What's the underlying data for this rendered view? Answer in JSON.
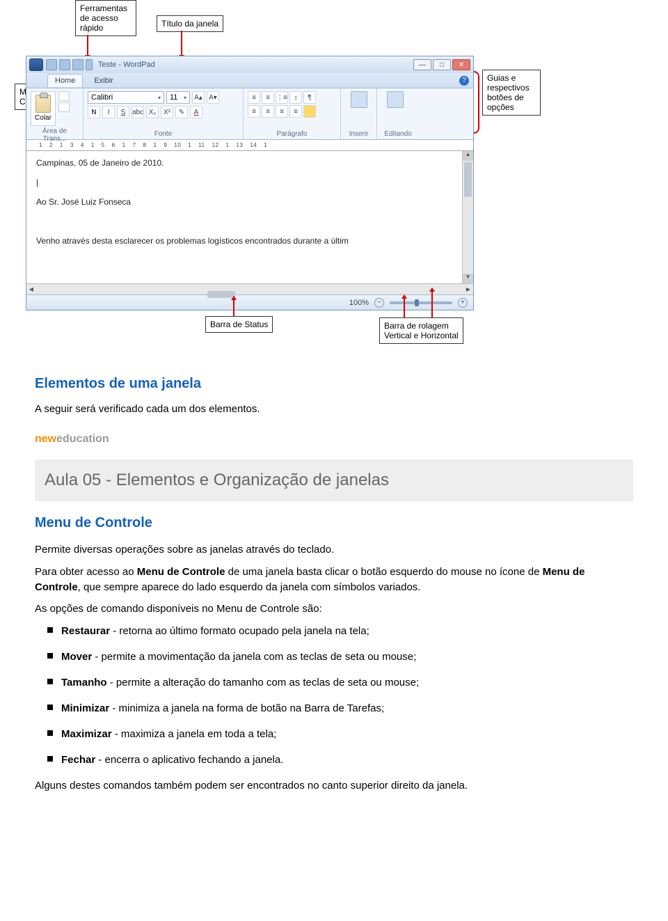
{
  "callouts": {
    "quick_access": "Ferramentas\nde acesso\nrápido",
    "title_bar": "Título da janela",
    "control_menu": "Menu de\nControle",
    "tabs_buttons": "Guias e\nrespectivos\nbotões de\nopções",
    "status_bar": "Barra de Status",
    "scroll_bars": "Barra de rolagem\nVertical e Horizontal"
  },
  "window": {
    "title": "Teste - WordPad",
    "tabs": {
      "home": "Home",
      "view": "Exibir"
    },
    "groups": {
      "clipboard": {
        "paste": "Colar",
        "label": "Área de Trans..."
      },
      "font": {
        "name": "Calibri",
        "size": "11",
        "label": "Fonte"
      },
      "paragraph": {
        "label": "Parágrafo"
      },
      "insert": {
        "label": "Inserir"
      },
      "editing": {
        "label": "Editando"
      }
    },
    "ruler": [
      "1",
      "2",
      "1",
      "3",
      "4",
      "1",
      "5",
      "6",
      "1",
      "7",
      "8",
      "1",
      "9",
      "10",
      "1",
      "11",
      "12",
      "1",
      "13",
      "14",
      "1"
    ],
    "document": {
      "line1": "Campinas, 05 de Janeiro de 2010.",
      "cursor": "|",
      "line2": "Ao Sr. José Luiz Fonseca",
      "line3": "Venho através desta esclarecer os problemas logísticos encontrados durante a últim"
    },
    "status": {
      "zoom": "100%",
      "minus": "−",
      "plus": "+"
    },
    "win_controls": {
      "min": "—",
      "max": "□",
      "close": "✕"
    }
  },
  "text": {
    "section_title": "Elementos de uma janela",
    "intro": "A seguir será verificado cada um dos elementos.",
    "logo_new": "new",
    "logo_education": "education",
    "banner": "Aula 05 - Elementos e Organização de janelas",
    "subheading": "Menu de Controle",
    "p1": "Permite diversas operações sobre as janelas através do teclado.",
    "p2_a": "Para obter acesso ao ",
    "p2_b": "Menu de Controle",
    "p2_c": " de uma janela basta clicar o botão esquerdo do mouse no ícone de ",
    "p2_d": "Menu de Controle",
    "p2_e": ", que sempre aparece do lado esquerdo da janela com símbolos variados.",
    "p3": "As opções de comando disponíveis no Menu de Controle são:",
    "options": [
      {
        "b": "Restaurar",
        "t": " - retorna ao último formato ocupado pela janela na tela;"
      },
      {
        "b": "Mover",
        "t": " - permite a movimentação da janela com as teclas de seta ou mouse;"
      },
      {
        "b": "Tamanho",
        "t": " - permite a alteração do tamanho com as teclas de seta ou mouse;"
      },
      {
        "b": "Minimizar",
        "t": " - minimiza a janela na forma de botão na Barra de Tarefas;"
      },
      {
        "b": "Maximizar",
        "t": " - maximiza a janela em toda a tela;"
      },
      {
        "b": "Fechar",
        "t": " - encerra o aplicativo fechando a janela."
      }
    ],
    "p4": "Alguns destes comandos também podem ser encontrados no canto superior direito da janela."
  }
}
